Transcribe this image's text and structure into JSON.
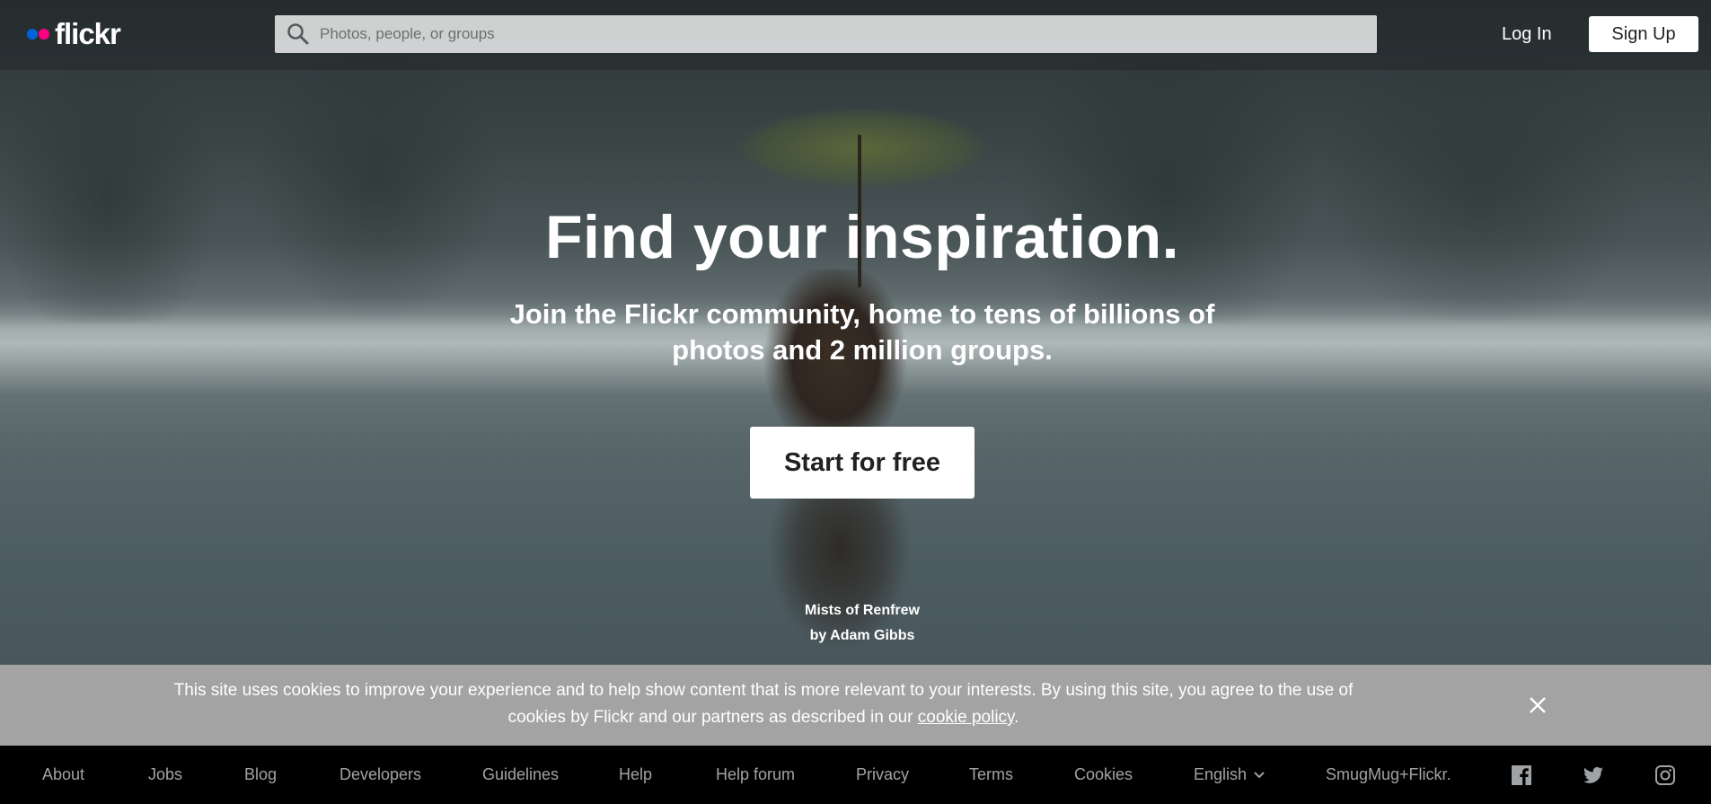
{
  "header": {
    "logo_text": "flickr",
    "search_placeholder": "Photos, people, or groups",
    "login_label": "Log In",
    "signup_label": "Sign Up"
  },
  "hero": {
    "title": "Find your inspiration.",
    "subtitle": "Join the Flickr community, home to tens of billions of photos and 2 million groups.",
    "cta_label": "Start for free",
    "photo_title": "Mists of Renfrew",
    "photo_author": "by Adam Gibbs"
  },
  "cookie_bar": {
    "text": "This site uses cookies to improve your experience and to help show content that is more relevant to your interests. By using this site, you agree to the use of cookies by Flickr and our partners as described in our",
    "link_text": "cookie policy",
    "text_end": "."
  },
  "footer": {
    "links": [
      "About",
      "Jobs",
      "Blog",
      "Developers",
      "Guidelines",
      "Help",
      "Help forum",
      "Privacy",
      "Terms",
      "Cookies"
    ],
    "language": "English",
    "smugmug": "SmugMug+Flickr.",
    "social_icons": [
      "facebook-icon",
      "twitter-icon",
      "instagram-icon"
    ]
  },
  "colors": {
    "flickr_blue": "#0063dc",
    "flickr_pink": "#ff0084",
    "cookie_bar": "#a3a3a3",
    "footer_bg": "#000000"
  }
}
